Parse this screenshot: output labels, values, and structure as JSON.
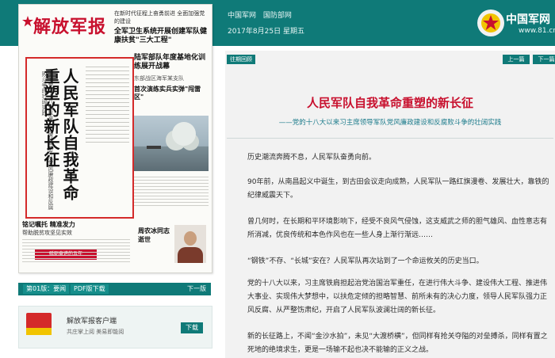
{
  "header": {
    "links": [
      "中国军网",
      "国防部网"
    ],
    "date": "2017年8月25日 星期五",
    "logo_text": "中国军网",
    "logo_url": "www.81.cn"
  },
  "newspaper": {
    "masthead": "解放军报",
    "top_right_kicker": "在新时代征程上奋勇前进 全面加强党的建设",
    "top_right_headline": "全军卫生系统开展创建军队健康扶贫\"三大工程\"",
    "red_box_headline": "人民军队自我革命重塑的新长征",
    "red_box_subtitle": "——党的十八大以来习主席领导军队党风廉政建设和反腐败斗争的壮阔实践",
    "red_banner": "砥砺奋进的五年",
    "right_story_headline": "陆军部队年度基地化训练展开战幕",
    "right_story_kicker": "东部战区海军某支队",
    "photo_caption": "首次演练实兵实弹\"闯雷区\"",
    "bottom_story_headline": "铭记嘱托 精准发力",
    "bottom_story_text": "帮助脱贫攻坚见实效",
    "portrait_story_headline": "周农冰同志逝世"
  },
  "pager": {
    "edition": "第01版：要闻",
    "pdf": "PDF版下载",
    "next": "下一版"
  },
  "app": {
    "title": "解放军报客户端",
    "subtitle": "共庄掌上阅 美易即能阅",
    "download": "下载"
  },
  "article": {
    "past_issues": "往期回顾",
    "prev": "上一篇",
    "next": "下一篇",
    "title": "人民军队自我革命重塑的新长征",
    "subtitle": "——党的十八大以来习主席领导军队党风廉政建设和反腐败斗争的壮阔实践",
    "paragraphs": [
      "历史潮流奔腾不息，人民军队奋勇向前。",
      "90年前，从南昌起义中诞生，到古田会议走向成熟，人民军队一路红旗漫卷、发展壮大，靠铁的纪律威震天下。",
      "曾几何时，在长期和平环境影响下，经受不良风气侵蚀，这支威武之师的胆气雄风、血性意志有所消减，优良传统和本色作风也在一些人身上渐行渐远……",
      "“钢铁”不存、“长城”安在？人民军队再次站到了一个命运攸关的历史当口。",
      "党的十八大以来，习主席铁肩担起治党治国治军重任，在进行伟大斗争、建设伟大工程、推进伟大事业、实现伟大梦想中，以扶危定倾的担略智慧、前所未有的决心力度，领导人民军队强力正风反腐、从严整饬肃纪，开启了人民军队波澜壮阔的新长征。",
      "新的长征路上，不闻“金沙水拍”，未见“大渡桥横”，但同样有抢关夺隘的对垒搏杀，同样有置之死地的绝境求生，更是一场输不起也决不能输的正义之战。"
    ]
  },
  "colors": {
    "teal": "#0f7a78",
    "red": "#c8102e",
    "subtitle_blue": "#1a7a8a"
  }
}
